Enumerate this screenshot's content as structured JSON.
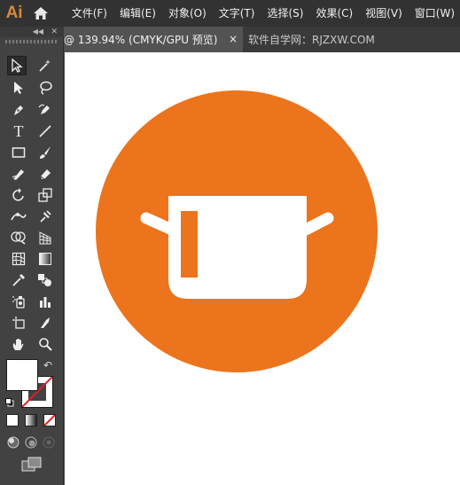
{
  "app": {
    "logo_text": "Ai"
  },
  "menu": {
    "items": [
      "文件(F)",
      "编辑(E)",
      "对象(O)",
      "文字(T)",
      "选择(S)",
      "效果(C)",
      "视图(V)",
      "窗口(W)"
    ]
  },
  "tabs": {
    "active_label": "@ 139.94% (CMYK/GPU 预览)",
    "close_glyph": "×",
    "inactive_label": "软件自学网：RJZXW.COM"
  },
  "tools": {
    "type_glyph": "T",
    "swap_glyph": "↶"
  },
  "colors": {
    "accent_orange": "#ec741c",
    "menubar_bg": "#323232",
    "panel_bg": "#424242",
    "workspace_bg": "#535353",
    "logo_color": "#ff9a00"
  },
  "artwork": {
    "subject": "cooking pot icon on orange circle"
  }
}
